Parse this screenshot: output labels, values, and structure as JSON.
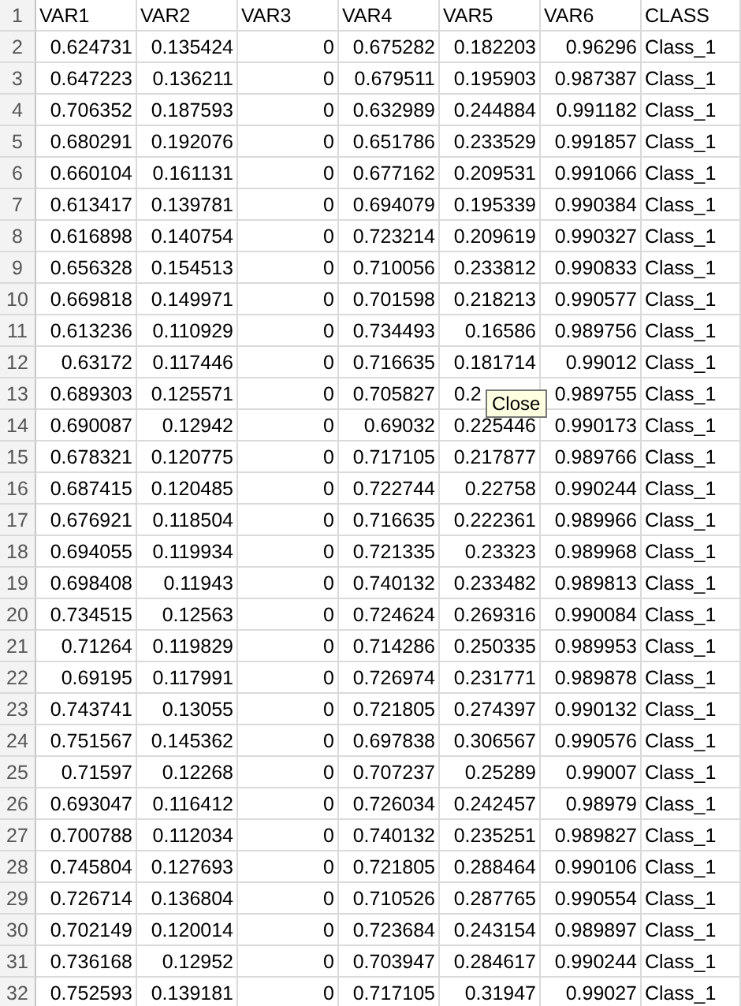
{
  "columns": [
    {
      "label": "VAR1",
      "kind": "number"
    },
    {
      "label": "VAR2",
      "kind": "number"
    },
    {
      "label": "VAR3",
      "kind": "number"
    },
    {
      "label": "VAR4",
      "kind": "number"
    },
    {
      "label": "VAR5",
      "kind": "number"
    },
    {
      "label": "VAR6",
      "kind": "number"
    },
    {
      "label": "CLASS",
      "kind": "text"
    }
  ],
  "header_row_number": "1",
  "rows": [
    {
      "number": "2",
      "cells": [
        "0.624731",
        "0.135424",
        "0",
        "0.675282",
        "0.182203",
        "0.96296",
        "Class_1"
      ]
    },
    {
      "number": "3",
      "cells": [
        "0.647223",
        "0.136211",
        "0",
        "0.679511",
        "0.195903",
        "0.987387",
        "Class_1"
      ]
    },
    {
      "number": "4",
      "cells": [
        "0.706352",
        "0.187593",
        "0",
        "0.632989",
        "0.244884",
        "0.991182",
        "Class_1"
      ]
    },
    {
      "number": "5",
      "cells": [
        "0.680291",
        "0.192076",
        "0",
        "0.651786",
        "0.233529",
        "0.991857",
        "Class_1"
      ]
    },
    {
      "number": "6",
      "cells": [
        "0.660104",
        "0.161131",
        "0",
        "0.677162",
        "0.209531",
        "0.991066",
        "Class_1"
      ]
    },
    {
      "number": "7",
      "cells": [
        "0.613417",
        "0.139781",
        "0",
        "0.694079",
        "0.195339",
        "0.990384",
        "Class_1"
      ]
    },
    {
      "number": "8",
      "cells": [
        "0.616898",
        "0.140754",
        "0",
        "0.723214",
        "0.209619",
        "0.990327",
        "Class_1"
      ]
    },
    {
      "number": "9",
      "cells": [
        "0.656328",
        "0.154513",
        "0",
        "0.710056",
        "0.233812",
        "0.990833",
        "Class_1"
      ]
    },
    {
      "number": "10",
      "cells": [
        "0.669818",
        "0.149971",
        "0",
        "0.701598",
        "0.218213",
        "0.990577",
        "Class_1"
      ]
    },
    {
      "number": "11",
      "cells": [
        "0.613236",
        "0.110929",
        "0",
        "0.734493",
        "0.16586",
        "0.989756",
        "Class_1"
      ]
    },
    {
      "number": "12",
      "cells": [
        "0.63172",
        "0.117446",
        "0",
        "0.716635",
        "0.181714",
        "0.99012",
        "Class_1"
      ]
    },
    {
      "number": "13",
      "cells": [
        "0.689303",
        "0.125571",
        "0",
        "0.705827",
        {
          "text": "0.2",
          "covered": true
        },
        "0.989755",
        "Class_1"
      ]
    },
    {
      "number": "14",
      "cells": [
        "0.690087",
        "0.12942",
        "0",
        "0.69032",
        "0.225446",
        "0.990173",
        "Class_1"
      ]
    },
    {
      "number": "15",
      "cells": [
        "0.678321",
        "0.120775",
        "0",
        "0.717105",
        "0.217877",
        "0.989766",
        "Class_1"
      ]
    },
    {
      "number": "16",
      "cells": [
        "0.687415",
        "0.120485",
        "0",
        "0.722744",
        "0.22758",
        "0.990244",
        "Class_1"
      ]
    },
    {
      "number": "17",
      "cells": [
        "0.676921",
        "0.118504",
        "0",
        "0.716635",
        "0.222361",
        "0.989966",
        "Class_1"
      ]
    },
    {
      "number": "18",
      "cells": [
        "0.694055",
        "0.119934",
        "0",
        "0.721335",
        "0.23323",
        "0.989968",
        "Class_1"
      ]
    },
    {
      "number": "19",
      "cells": [
        "0.698408",
        "0.11943",
        "0",
        "0.740132",
        "0.233482",
        "0.989813",
        "Class_1"
      ]
    },
    {
      "number": "20",
      "cells": [
        "0.734515",
        "0.12563",
        "0",
        "0.724624",
        "0.269316",
        "0.990084",
        "Class_1"
      ]
    },
    {
      "number": "21",
      "cells": [
        "0.71264",
        "0.119829",
        "0",
        "0.714286",
        "0.250335",
        "0.989953",
        "Class_1"
      ]
    },
    {
      "number": "22",
      "cells": [
        "0.69195",
        "0.117991",
        "0",
        "0.726974",
        "0.231771",
        "0.989878",
        "Class_1"
      ]
    },
    {
      "number": "23",
      "cells": [
        "0.743741",
        "0.13055",
        "0",
        "0.721805",
        "0.274397",
        "0.990132",
        "Class_1"
      ]
    },
    {
      "number": "24",
      "cells": [
        "0.751567",
        "0.145362",
        "0",
        "0.697838",
        "0.306567",
        "0.990576",
        "Class_1"
      ]
    },
    {
      "number": "25",
      "cells": [
        "0.71597",
        "0.12268",
        "0",
        "0.707237",
        "0.25289",
        "0.99007",
        "Class_1"
      ]
    },
    {
      "number": "26",
      "cells": [
        "0.693047",
        "0.116412",
        "0",
        "0.726034",
        "0.242457",
        "0.98979",
        "Class_1"
      ]
    },
    {
      "number": "27",
      "cells": [
        "0.700788",
        "0.112034",
        "0",
        "0.740132",
        "0.235251",
        "0.989827",
        "Class_1"
      ]
    },
    {
      "number": "28",
      "cells": [
        "0.745804",
        "0.127693",
        "0",
        "0.721805",
        "0.288464",
        "0.990106",
        "Class_1"
      ]
    },
    {
      "number": "29",
      "cells": [
        "0.726714",
        "0.136804",
        "0",
        "0.710526",
        "0.287765",
        "0.990554",
        "Class_1"
      ]
    },
    {
      "number": "30",
      "cells": [
        "0.702149",
        "0.120014",
        "0",
        "0.723684",
        "0.243154",
        "0.989897",
        "Class_1"
      ]
    },
    {
      "number": "31",
      "cells": [
        "0.736168",
        "0.12952",
        "0",
        "0.703947",
        "0.284617",
        "0.990244",
        "Class_1"
      ]
    },
    {
      "number": "32",
      "cells": [
        "0.752593",
        "0.139181",
        "0",
        "0.717105",
        "0.31947",
        "0.99027",
        "Class_1"
      ]
    }
  ],
  "tooltip": {
    "text": "Close"
  }
}
